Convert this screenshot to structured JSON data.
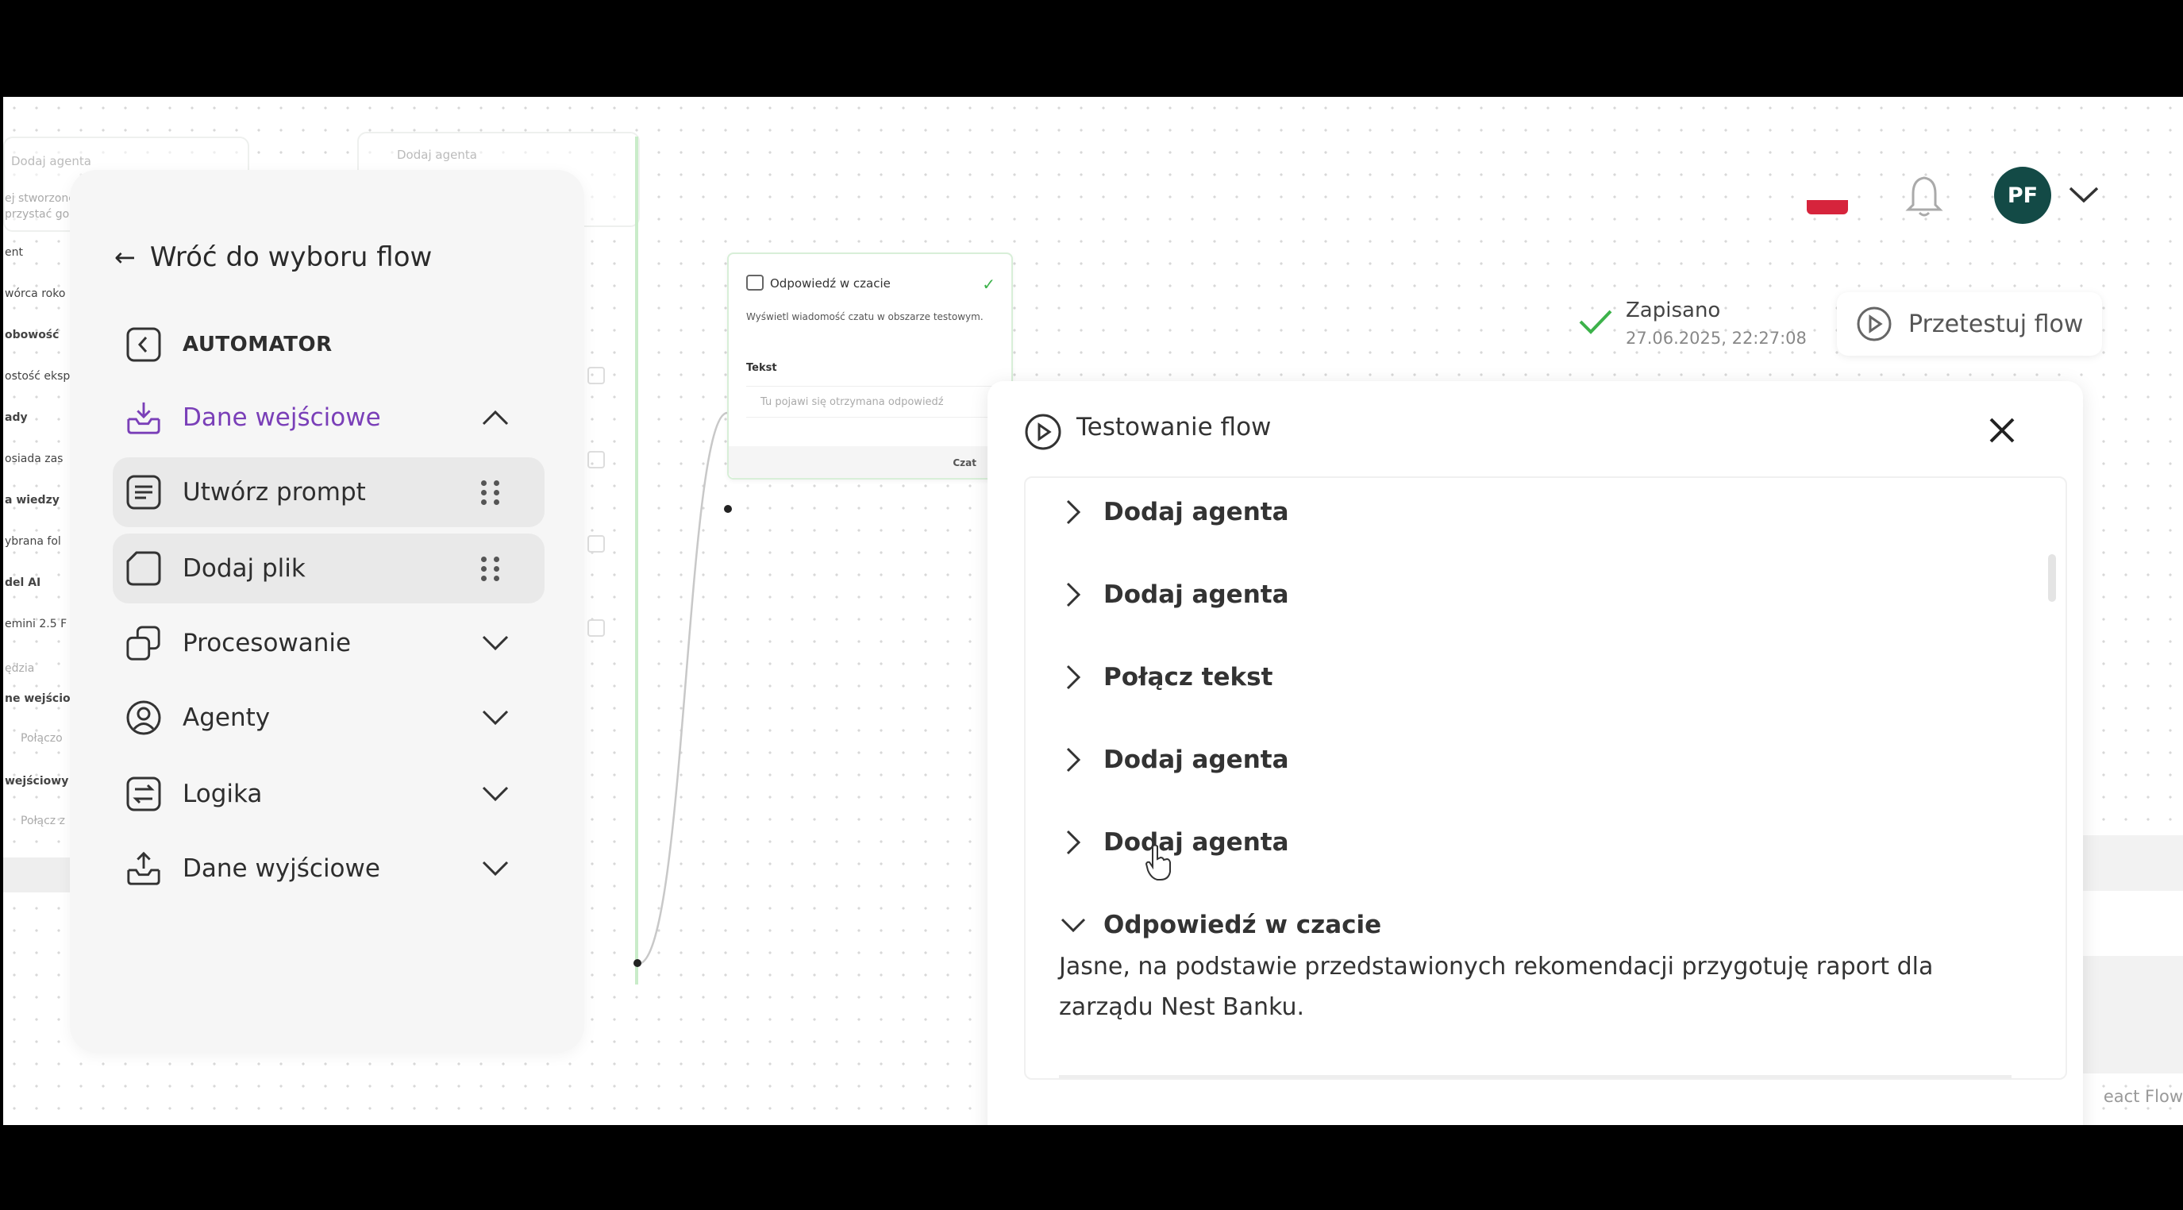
{
  "sidebar": {
    "back_label": "Wróć do wyboru flow",
    "items": [
      {
        "label": "AUTOMATOR"
      },
      {
        "label": "Dane wejściowe"
      },
      {
        "label": "Utwórz prompt"
      },
      {
        "label": "Dodaj plik"
      },
      {
        "label": "Procesowanie"
      },
      {
        "label": "Agenty"
      },
      {
        "label": "Logika"
      },
      {
        "label": "Dane wyjściowe"
      }
    ]
  },
  "background_canvas": {
    "ghost_nodes": [
      "Dodaj agenta",
      "Dodaj agenta"
    ],
    "left_labels": [
      "ej stworzone",
      "przystać go v",
      "ent",
      "wórca roko",
      "obowość",
      "ostość eksp",
      "ady",
      "osiada zas",
      "a wiedzy",
      "ybrana fol",
      "del AI",
      "emini 2.5 F",
      "ędzia",
      "ne wejściov",
      "Połączo",
      "wejściowy",
      "Połącz z"
    ],
    "react_flow_label": "eact Flow"
  },
  "node": {
    "title": "Odpowiedź w czacie",
    "description": "Wyświetl wiadomość czatu w obszarze testowym.",
    "field_label": "Tekst",
    "output_placeholder": "Tu pojawi się otrzymana odpowiedź",
    "footer": "Czat"
  },
  "topbar": {
    "avatar_initials": "PF",
    "flag_colors": [
      "#ffffff",
      "#d6243c"
    ],
    "icons": [
      "flag-icon",
      "bell-icon",
      "chevron-down-icon"
    ]
  },
  "status": {
    "saved_label": "Zapisano",
    "saved_time": "27.06.2025, 22:27:08"
  },
  "test_button": {
    "label": "Przetestuj flow"
  },
  "panel": {
    "title": "Testowanie flow",
    "steps": [
      {
        "label": "Dodaj agenta",
        "expanded": false
      },
      {
        "label": "Dodaj agenta",
        "expanded": false
      },
      {
        "label": "Połącz tekst",
        "expanded": false
      },
      {
        "label": "Dodaj agenta",
        "expanded": false
      },
      {
        "label": "Dodaj agenta",
        "expanded": false
      },
      {
        "label": "Odpowiedź w czacie",
        "expanded": true
      }
    ],
    "response_text": "Jasne, na podstawie przedstawionych rekomendacji przygotuję raport dla zarządu Nest Banku."
  },
  "colors": {
    "accent_purple": "#7a3fb8",
    "avatar_bg": "#134a46",
    "success_green": "#3cb24a"
  }
}
